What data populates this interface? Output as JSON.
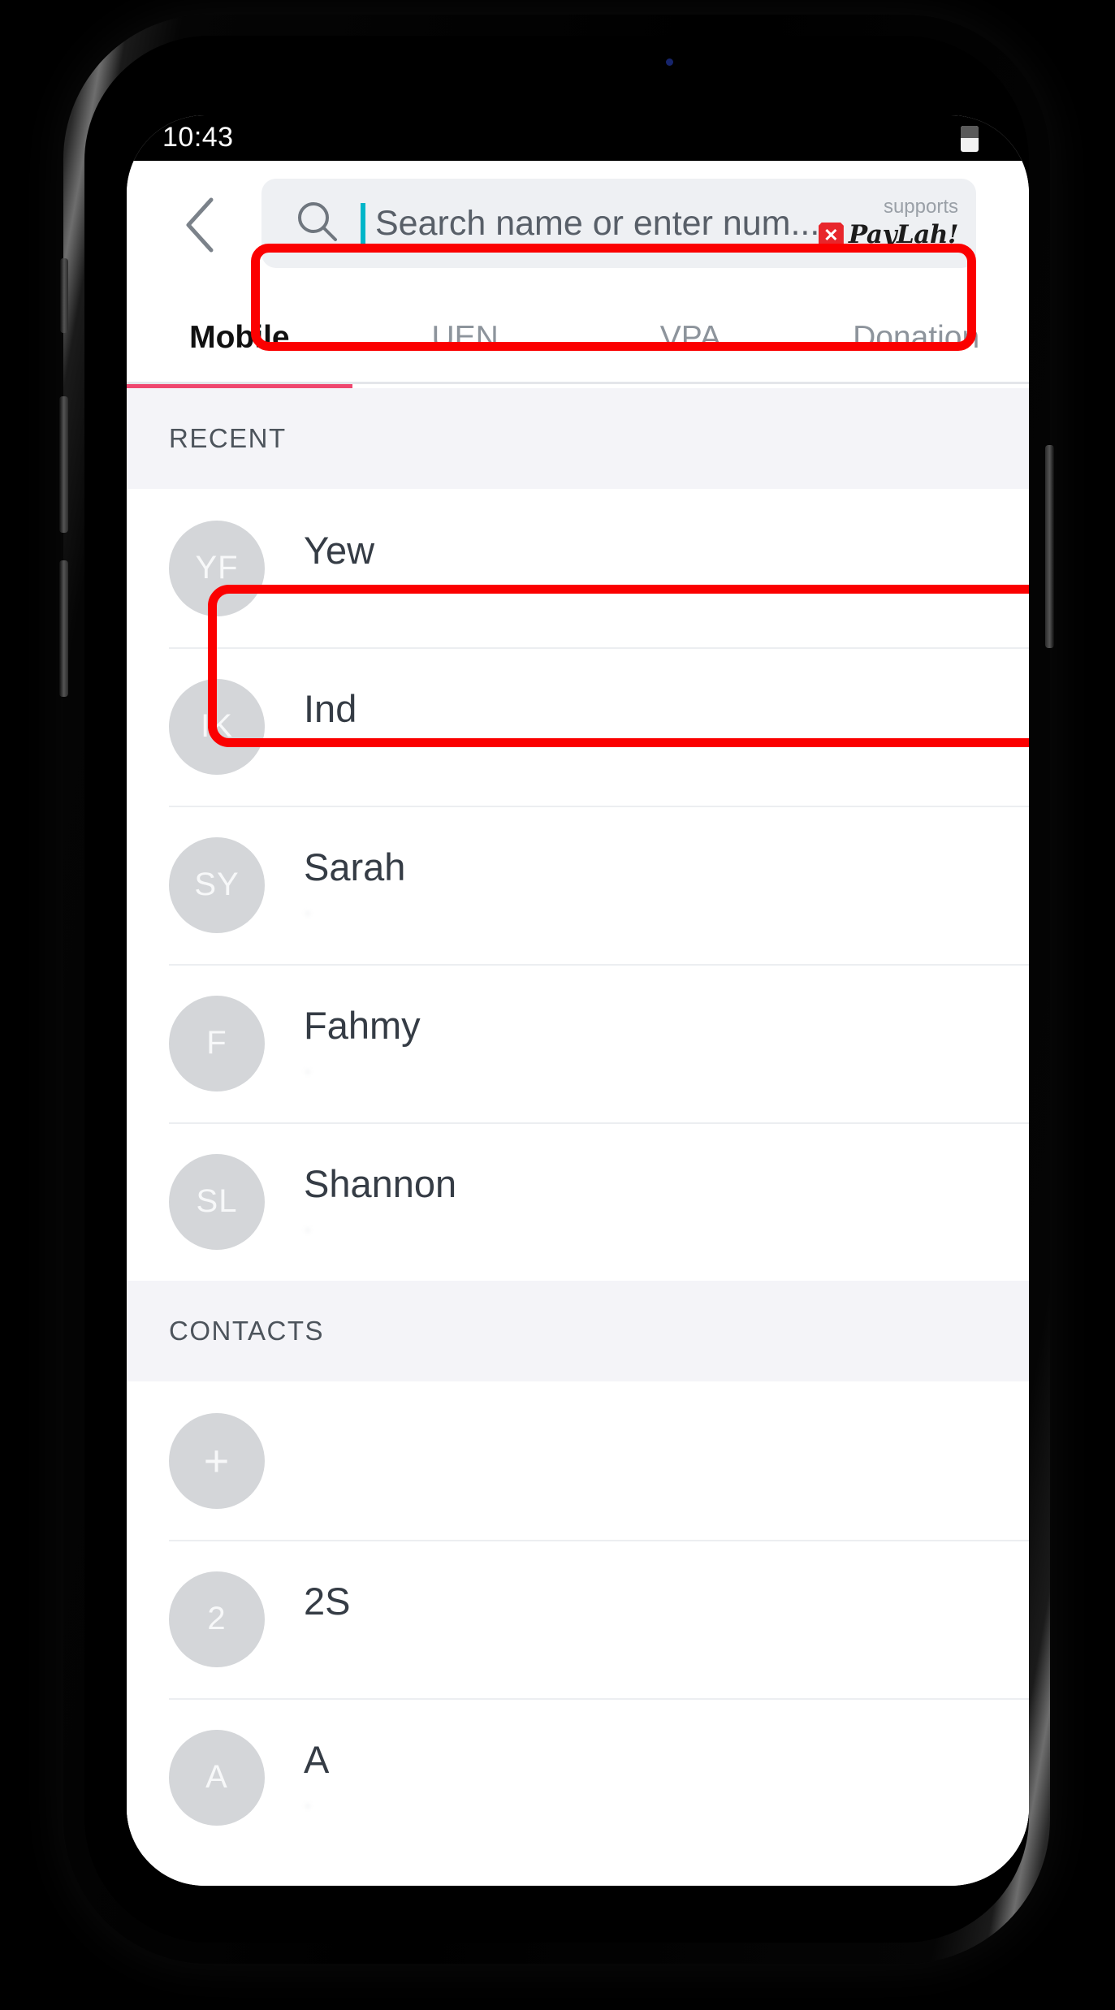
{
  "status_bar": {
    "time": "10:43",
    "battery_icon": "battery-icon"
  },
  "app_bar": {
    "back_icon": "chevron-left-icon",
    "search": {
      "icon": "search-icon",
      "value": "",
      "placeholder": "Search name or enter num...",
      "caret_color": "#00b6c9"
    },
    "paylah": {
      "supports_label": "supports",
      "badge_glyph": "✕",
      "wordmark": "PayLah!",
      "badge_color": "#e8262b"
    }
  },
  "tabs": {
    "active_index": 0,
    "accent_color": "#ef476f",
    "items": [
      {
        "label": "Mobile"
      },
      {
        "label": "UEN"
      },
      {
        "label": "VPA"
      },
      {
        "label": "Donation"
      }
    ]
  },
  "sections": [
    {
      "header": "RECENT",
      "rows": [
        {
          "initials": "YF",
          "name": "Yew",
          "sub": "",
          "highlighted": true
        },
        {
          "initials": "IK",
          "name": "Ind",
          "sub": ""
        },
        {
          "initials": "SY",
          "name": "Sarah",
          "sub": "·"
        },
        {
          "initials": "F",
          "name": "Fahmy",
          "sub": "·"
        },
        {
          "initials": "SL",
          "name": "Shannon",
          "sub": "·"
        }
      ]
    },
    {
      "header": "CONTACTS",
      "rows": [
        {
          "initials": "+",
          "name": " ",
          "sub": "",
          "add_row": true,
          "name_blurred": true
        },
        {
          "initials": "2",
          "name": "2S",
          "sub": ""
        },
        {
          "initials": "A",
          "name": "A",
          "sub": "·"
        }
      ]
    }
  ],
  "annotations": {
    "color": "#fb0000",
    "boxes": [
      {
        "target": "search-field"
      },
      {
        "target": "recent-contact-yew"
      }
    ]
  }
}
